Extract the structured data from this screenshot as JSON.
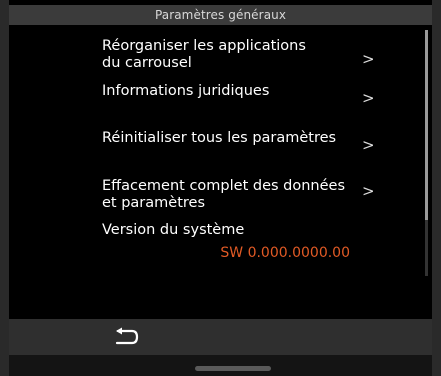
{
  "header": {
    "title": "Paramètres généraux"
  },
  "menu": {
    "items": [
      {
        "label": "Réorganiser les applications\ndu carrousel",
        "chevron": ">"
      },
      {
        "label": "Informations juridiques",
        "chevron": ">"
      },
      {
        "label": "Réinitialiser tous les paramètres",
        "chevron": ">"
      },
      {
        "label": "Effacement complet des données\net paramètres",
        "chevron": ">"
      }
    ],
    "version": {
      "label": "Version du système",
      "value": "SW 0.000.0000.00"
    }
  },
  "bottom": {
    "back_icon": "return-arrow-icon"
  },
  "colors": {
    "version_value": "#e15a25",
    "header_bg": "#3b3b3b",
    "background": "#000000"
  }
}
